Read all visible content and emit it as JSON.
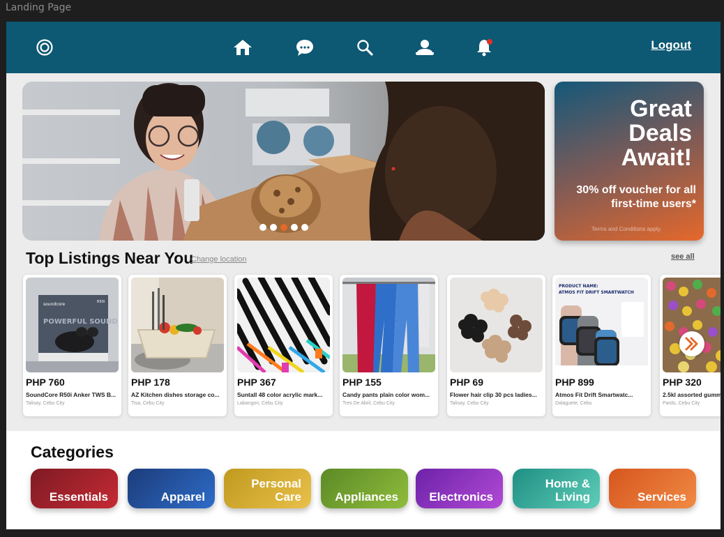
{
  "window": {
    "title": "Landing Page"
  },
  "navbar": {
    "logo_icon": "circle-logo-icon",
    "items": [
      {
        "name": "home",
        "icon": "home-icon"
      },
      {
        "name": "messages",
        "icon": "chat-bubble-icon"
      },
      {
        "name": "search",
        "icon": "search-icon"
      },
      {
        "name": "profile",
        "icon": "user-icon"
      },
      {
        "name": "notifications",
        "icon": "bell-icon",
        "badge_color": "#e0302a"
      }
    ],
    "logout_label": "Logout",
    "background_color": "#0d5873"
  },
  "hero": {
    "carousel_slide_count": 5,
    "active_slide_index": 2,
    "active_dot_color": "#e4692b"
  },
  "promo": {
    "title": "Great Deals Await!",
    "subtitle": "30% off voucher for all first-time users*",
    "terms": "Terms and Conditions apply."
  },
  "listings": {
    "title": "Top Listings Near You",
    "change_location_label": "Change location",
    "see_all_label": "see all",
    "items": [
      {
        "price": "PHP 760",
        "title": "SoundCore R50i Anker TWS B...",
        "location": "Talisay, Cebu City"
      },
      {
        "price": "PHP 178",
        "title": "AZ Kitchen dishes storage co...",
        "location": "Tisa, Cebu City"
      },
      {
        "price": "PHP 367",
        "title": "Suntall 48 color acrylic mark...",
        "location": "Labangon, Cebu City"
      },
      {
        "price": "PHP 155",
        "title": "Candy pants plain color wom...",
        "location": "Tres De Abril, Cebu City"
      },
      {
        "price": "PHP 69",
        "title": "Flower hair clip 30 pcs ladies...",
        "location": "Talisay, Cebu City"
      },
      {
        "price": "PHP 899",
        "title": "Atmos Fit Drift Smartwatc...",
        "location": "Dalaguete, Cebu"
      },
      {
        "price": "PHP 320",
        "title": "2.5kl assorted gumm",
        "location": "Pardo, Cebu City"
      }
    ],
    "image_text": {
      "soundcore_brand": "soundcore",
      "soundcore_model": "R50i",
      "soundcore_slogan": "POWERFUL SOUND",
      "watch_product_label": "PRODUCT NAME:",
      "watch_product_name": "ATMOS FIT DRIFT SMARTWATCH"
    },
    "next_icon": "double-chevron-right-icon",
    "next_icon_color": "#e4692b"
  },
  "categories": {
    "title": "Categories",
    "items": [
      {
        "label": "Essentials",
        "color_from": "#7e1a24",
        "color_to": "#c52a33"
      },
      {
        "label": "Apparel",
        "color_from": "#1c3c7a",
        "color_to": "#2e6cc8"
      },
      {
        "label": "Personal\nCare",
        "color_from": "#c09a1f",
        "color_to": "#e9c04a"
      },
      {
        "label": "Appliances",
        "color_from": "#5c8a26",
        "color_to": "#8fbc3c"
      },
      {
        "label": "Electronics",
        "color_from": "#6c22a8",
        "color_to": "#b24ad6"
      },
      {
        "label": "Home &\nLiving",
        "color_from": "#1f8f84",
        "color_to": "#5ecdb8"
      },
      {
        "label": "Services",
        "color_from": "#d6561e",
        "color_to": "#f08a44"
      }
    ]
  }
}
